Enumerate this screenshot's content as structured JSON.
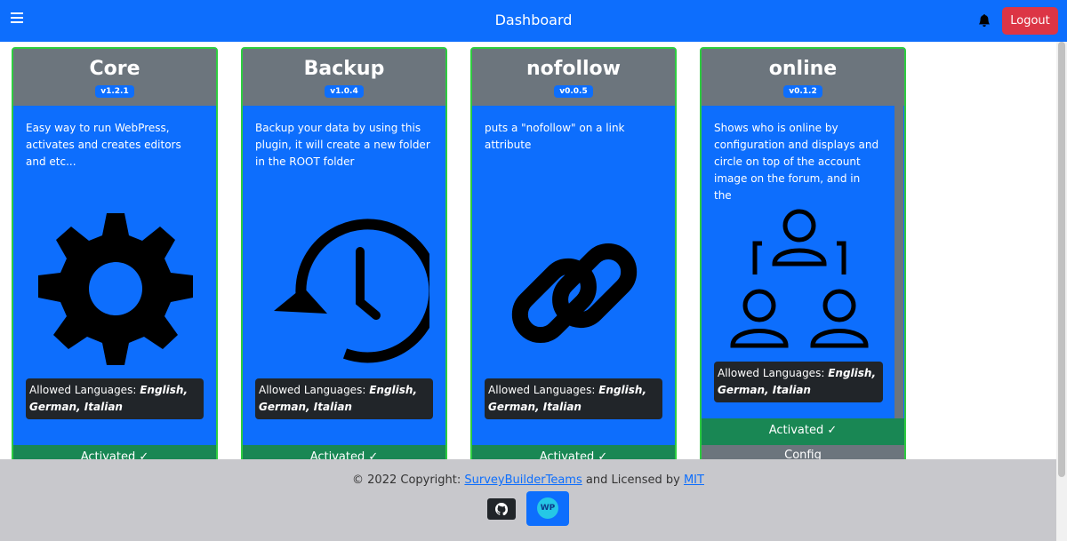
{
  "navbar": {
    "title": "Dashboard",
    "logout_label": "Logout"
  },
  "plugins": [
    {
      "title": "Core",
      "version": "v1.2.1",
      "description": "Easy way to run WebPress, activates and creates editors and etc...",
      "lang_label": "Allowed Languages:",
      "lang_values": "English, German, Italian",
      "status": "Activated ✓",
      "icon": "gear-icon"
    },
    {
      "title": "Backup",
      "version": "v1.0.4",
      "description": "Backup your data by using this plugin, it will create a new folder in the ROOT folder",
      "lang_label": "Allowed Languages:",
      "lang_values": "English, German, Italian",
      "status": "Activated ✓",
      "icon": "history-clock-icon"
    },
    {
      "title": "nofollow",
      "version": "v0.0.5",
      "description": "puts a \"nofollow\" on a link attribute",
      "lang_label": "Allowed Languages:",
      "lang_values": "English, German, Italian",
      "status": "Activated ✓",
      "icon": "link-icon"
    },
    {
      "title": "online",
      "version": "v0.1.2",
      "description": "Shows who is online by configuration and displays and circle on top of the account image on the forum, and in the",
      "lang_label": "Allowed Languages:",
      "lang_values": "English, German, Italian",
      "status": "Activated ✓",
      "config": "Config",
      "icon": "users-online-icon"
    }
  ],
  "footer": {
    "copyright": "© 2022 Copyright:",
    "team_link": "SurveyBuilderTeams",
    "license_text": "and Licensed by",
    "license_link": "MIT",
    "wp_label": "WP"
  },
  "colors": {
    "primary": "#0d6efd",
    "header_gray": "#6c757d",
    "success": "#198754",
    "danger": "#dc3545",
    "card_border": "#2ecc40"
  }
}
